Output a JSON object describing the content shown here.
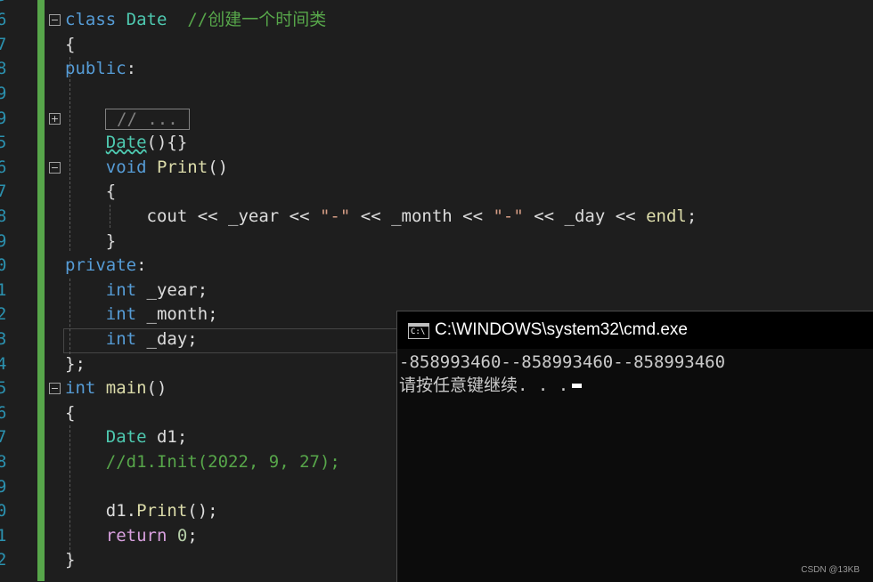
{
  "editor": {
    "line_numbers": [
      "5",
      "6",
      "7",
      "8",
      "9",
      "5",
      "6",
      "7",
      "8",
      "9",
      "0",
      "1",
      "2",
      "3",
      "4",
      "5",
      "6",
      "7",
      "8",
      "9",
      "0",
      "1",
      "2"
    ],
    "code": {
      "l1_kw": "class",
      "l1_type": "Date",
      "l1_comment": "//创建一个时间类",
      "l2": "{",
      "l3_kw": "public",
      "l3_colon": ":",
      "l5_collapsed": "// ...",
      "l6_ctor": "Date",
      "l6_rest": "(){}",
      "l7_kw": "void",
      "l7_fn": "Print",
      "l7_rest": "()",
      "l8": "{",
      "l9_a": "cout << _year << ",
      "l9_s1": "\"-\"",
      "l9_b": " << _month << ",
      "l9_s2": "\"-\"",
      "l9_c": " << _day << ",
      "l9_endl": "endl",
      "l9_semi": ";",
      "l10": "}",
      "l11_kw": "private",
      "l11_colon": ":",
      "l12_kw": "int",
      "l12_rest": " _year;",
      "l13_kw": "int",
      "l13_rest": " _month;",
      "l14_kw": "int",
      "l14_rest": " _day;",
      "l15": "};",
      "l16_kw": "int",
      "l16_fn": "main",
      "l16_rest": "()",
      "l17": "{",
      "l18_type": "Date",
      "l18_rest": " d1;",
      "l19_comment": "//d1.Init(2022, 9, 27);",
      "l21_obj": "d1.",
      "l21_fn": "Print",
      "l21_rest": "();",
      "l22_kw": "return",
      "l22_num": "0",
      "l22_semi": ";",
      "l23": "}"
    },
    "fold_markers": {
      "minus": "−",
      "plus": "+"
    }
  },
  "console": {
    "title": "C:\\WINDOWS\\system32\\cmd.exe",
    "icon_label": "C:\\",
    "output_line1": "-858993460--858993460--858993460",
    "output_line2": "请按任意键继续. . ."
  },
  "watermark": "CSDN @13KB",
  "colors": {
    "keyword": "#569cd6",
    "type": "#4ec9b0",
    "function": "#dcdcaa",
    "comment": "#57a64a",
    "string": "#d69d85",
    "control": "#d8a0df"
  }
}
